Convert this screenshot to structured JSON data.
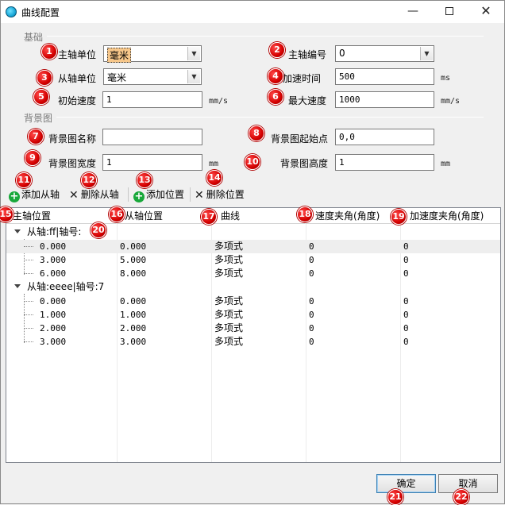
{
  "window": {
    "title": "曲线配置",
    "minimize_label": "—",
    "close_label": "✕"
  },
  "sections": {
    "basic": "基础",
    "background": "背景图"
  },
  "fields": {
    "master_unit": {
      "label": "主轴单位",
      "value": "毫米"
    },
    "master_id": {
      "label": "主轴编号",
      "value": "0"
    },
    "slave_unit": {
      "label": "从轴单位",
      "value": "毫米"
    },
    "accel_time": {
      "label": "加速时间",
      "value": "500",
      "unit": "ms"
    },
    "initial_speed": {
      "label": "初始速度",
      "value": "1",
      "unit": "mm/s"
    },
    "max_speed": {
      "label": "最大速度",
      "value": "1000",
      "unit": "mm/s"
    },
    "bg_name": {
      "label": "背景图名称",
      "value": ""
    },
    "bg_origin": {
      "label": "背景图起始点",
      "value": "0,0"
    },
    "bg_width": {
      "label": "背景图宽度",
      "value": "1",
      "unit": "mm"
    },
    "bg_height": {
      "label": "背景图高度",
      "value": "1",
      "unit": "mm"
    }
  },
  "toolbar": {
    "add_slave": "添加从轴",
    "remove_slave": "删除从轴",
    "add_position": "添加位置",
    "remove_position": "删除位置"
  },
  "grid": {
    "headers": [
      "主轴位置",
      "从轴位置",
      "曲线",
      "速度夹角(角度)",
      "加速度夹角(角度)"
    ],
    "groups": [
      {
        "label": "从轴:ff|轴号:",
        "rows": [
          [
            "0.000",
            "0.000",
            "多项式",
            "0",
            "0"
          ],
          [
            "3.000",
            "5.000",
            "多项式",
            "0",
            "0"
          ],
          [
            "6.000",
            "8.000",
            "多项式",
            "0",
            "0"
          ]
        ]
      },
      {
        "label": "从轴:eeee|轴号:7",
        "rows": [
          [
            "0.000",
            "0.000",
            "多项式",
            "0",
            "0"
          ],
          [
            "1.000",
            "1.000",
            "多项式",
            "0",
            "0"
          ],
          [
            "2.000",
            "2.000",
            "多项式",
            "0",
            "0"
          ],
          [
            "3.000",
            "3.000",
            "多项式",
            "0",
            "0"
          ]
        ]
      }
    ]
  },
  "buttons": {
    "ok": "确定",
    "cancel": "取消"
  },
  "badges": [
    "1",
    "2",
    "3",
    "4",
    "5",
    "6",
    "7",
    "8",
    "9",
    "10",
    "11",
    "12",
    "13",
    "14",
    "15",
    "16",
    "17",
    "18",
    "19",
    "20",
    "21",
    "22"
  ],
  "colors": {
    "badge": "#d40000",
    "add_icon": "#18a83a",
    "selected_combo": "#f7c78a"
  }
}
